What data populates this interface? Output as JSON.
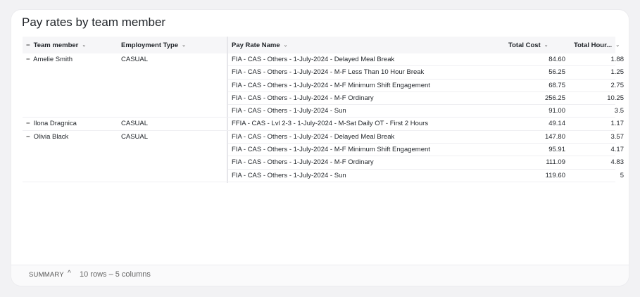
{
  "title": "Pay rates by team member",
  "columns": {
    "team_member": "Team member",
    "employment_type": "Employment Type",
    "pay_rate_name": "Pay Rate Name",
    "total_cost": "Total Cost",
    "total_hours": "Total Hour..."
  },
  "groups": [
    {
      "member": "Amelie Smith",
      "type": "CASUAL",
      "rows": [
        {
          "name": "FIA - CAS - Others - 1-July-2024 - Delayed Meal Break",
          "cost": "84.60",
          "hours": "1.88"
        },
        {
          "name": "FIA - CAS - Others - 1-July-2024 - M-F Less Than 10 Hour Break",
          "cost": "56.25",
          "hours": "1.25"
        },
        {
          "name": "FIA - CAS - Others - 1-July-2024 - M-F Minimum Shift Engagement",
          "cost": "68.75",
          "hours": "2.75"
        },
        {
          "name": "FIA - CAS - Others - 1-July-2024 - M-F Ordinary",
          "cost": "256.25",
          "hours": "10.25"
        },
        {
          "name": "FIA - CAS - Others - 1-July-2024 - Sun",
          "cost": "91.00",
          "hours": "3.5"
        }
      ]
    },
    {
      "member": "Ilona Dragnica",
      "type": "CASUAL",
      "rows": [
        {
          "name": "FFIA - CAS - Lvl 2-3 - 1-July-2024 - M-Sat Daily OT - First 2 Hours",
          "cost": "49.14",
          "hours": "1.17"
        }
      ]
    },
    {
      "member": "Olivia Black",
      "type": "CASUAL",
      "rows": [
        {
          "name": "FIA - CAS - Others - 1-July-2024 - Delayed Meal Break",
          "cost": "147.80",
          "hours": "3.57"
        },
        {
          "name": "FIA - CAS - Others - 1-July-2024 - M-F Minimum Shift Engagement",
          "cost": "95.91",
          "hours": "4.17"
        },
        {
          "name": "FIA - CAS - Others - 1-July-2024 - M-F Ordinary",
          "cost": "111.09",
          "hours": "4.83"
        },
        {
          "name": "FIA - CAS - Others - 1-July-2024 - Sun",
          "cost": "119.60",
          "hours": "5"
        }
      ]
    }
  ],
  "summary": {
    "label": "SUMMARY",
    "info": "10 rows – 5 columns"
  },
  "icons": {
    "collapse": "minus-icon",
    "sort": "chevron-down-icon",
    "summary_toggle": "chevron-up-icon"
  }
}
